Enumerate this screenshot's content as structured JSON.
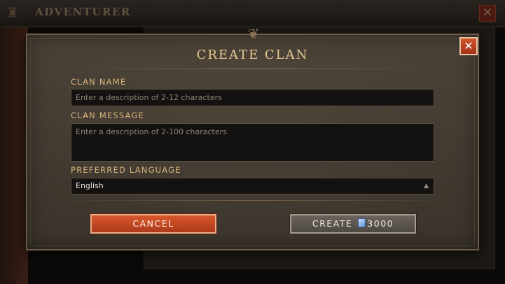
{
  "background": {
    "title": "ADVENTURER",
    "close_glyph": "✕"
  },
  "dialog": {
    "title": "CREATE CLAN",
    "close_glyph": "✕",
    "clan_name": {
      "label": "CLAN NAME",
      "placeholder": "Enter a description of 2-12 characters"
    },
    "clan_message": {
      "label": "CLAN MESSAGE",
      "placeholder": "Enter a description of 2-100 characters"
    },
    "preferred_language": {
      "label": "PREFERRED LANGUAGE",
      "value": "English",
      "arrow_glyph": "▲"
    },
    "cancel_button": {
      "label": "CANCEL"
    },
    "create_button": {
      "label": "CREATE",
      "cost": "3000",
      "cost_icon": "gem-icon"
    }
  },
  "colors": {
    "accent_gold": "#e6c98f",
    "cancel_red": "#d7572c"
  }
}
